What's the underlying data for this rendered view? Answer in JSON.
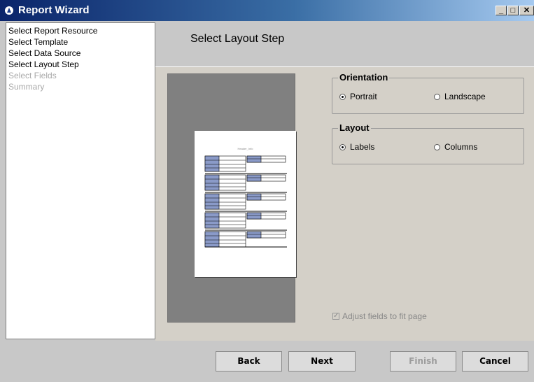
{
  "window": {
    "title": "Report Wizard"
  },
  "steps": [
    {
      "label": "Select Report Resource",
      "enabled": true
    },
    {
      "label": "Select Template",
      "enabled": true
    },
    {
      "label": "Select Data Source",
      "enabled": true
    },
    {
      "label": "Select Layout Step",
      "enabled": true
    },
    {
      "label": "Select Fields",
      "enabled": false
    },
    {
      "label": "Summary",
      "enabled": false
    }
  ],
  "header": {
    "title": "Select Layout Step"
  },
  "preview": {
    "page_title": "Header_Info"
  },
  "orientation": {
    "legend": "Orientation",
    "portrait": "Portrait",
    "landscape": "Landscape",
    "selected": "Portrait"
  },
  "layout": {
    "legend": "Layout",
    "labels": "Labels",
    "columns": "Columns",
    "selected": "Labels"
  },
  "adjust": {
    "label": "Adjust fields to fit page",
    "checked": true
  },
  "buttons": {
    "back": "Back",
    "next": "Next",
    "finish": "Finish",
    "cancel": "Cancel"
  },
  "colors": {
    "titlebar_start": "#0a246a",
    "titlebar_end": "#a6caf0",
    "preview_bg": "#808080"
  }
}
